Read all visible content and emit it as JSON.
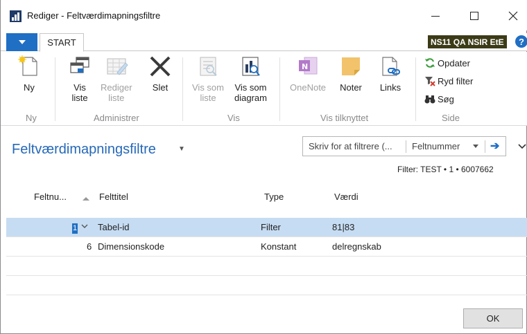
{
  "window": {
    "title": "Rediger - Feltværdimapningsfiltre"
  },
  "tabs": {
    "start_label": "START"
  },
  "company_badge": "NS11 QA NSIR EtE",
  "help_glyph": "?",
  "ribbon": {
    "groups": {
      "ny": "Ny",
      "administrer": "Administrer",
      "vis": "Vis",
      "vis_tilknyttet": "Vis tilknyttet",
      "side": "Side"
    },
    "buttons": {
      "ny": "Ny",
      "vis_liste_1": "Vis",
      "vis_liste_2": "liste",
      "rediger_liste_1": "Rediger",
      "rediger_liste_2": "liste",
      "slet": "Slet",
      "vis_som_liste_1": "Vis som",
      "vis_som_liste_2": "liste",
      "vis_som_diagram_1": "Vis som",
      "vis_som_diagram_2": "diagram",
      "onenote": "OneNote",
      "noter": "Noter",
      "links": "Links",
      "opdater": "Opdater",
      "ryd_filter": "Ryd filter",
      "soeg": "Søg"
    }
  },
  "page": {
    "title": "Feltværdimapningsfiltre",
    "filter_placeholder": "Skriv for at filtrere (...",
    "filter_field": "Feltnummer",
    "filter_summary": "Filter: TEST • 1 • 6007662"
  },
  "table": {
    "columns": [
      "Feltnu...",
      "Felttitel",
      "Type",
      "Værdi"
    ],
    "rows": [
      {
        "feltnummer": "1",
        "felttitel": "Tabel-id",
        "type": "Filter",
        "vaerdi": "81|83"
      },
      {
        "feltnummer": "6",
        "felttitel": "Dimensionskode",
        "type": "Konstant",
        "vaerdi": "delregnskab"
      }
    ]
  },
  "footer": {
    "ok_label": "OK"
  },
  "colors": {
    "accent": "#1f6fc4",
    "title_blue": "#2568b8",
    "selected_row": "#c6dcf2",
    "badge_bg": "#3c3b17"
  },
  "icons": [
    "app-icon",
    "minimize-icon",
    "maximize-icon",
    "close-icon",
    "new-doc-icon",
    "view-list-icon",
    "edit-list-icon",
    "delete-icon",
    "view-as-list-icon",
    "view-as-chart-icon",
    "onenote-icon",
    "notes-icon",
    "links-icon",
    "refresh-icon",
    "clear-filter-icon",
    "search-binoculars-icon",
    "arrow-right-icon",
    "chevron-down-icon"
  ]
}
